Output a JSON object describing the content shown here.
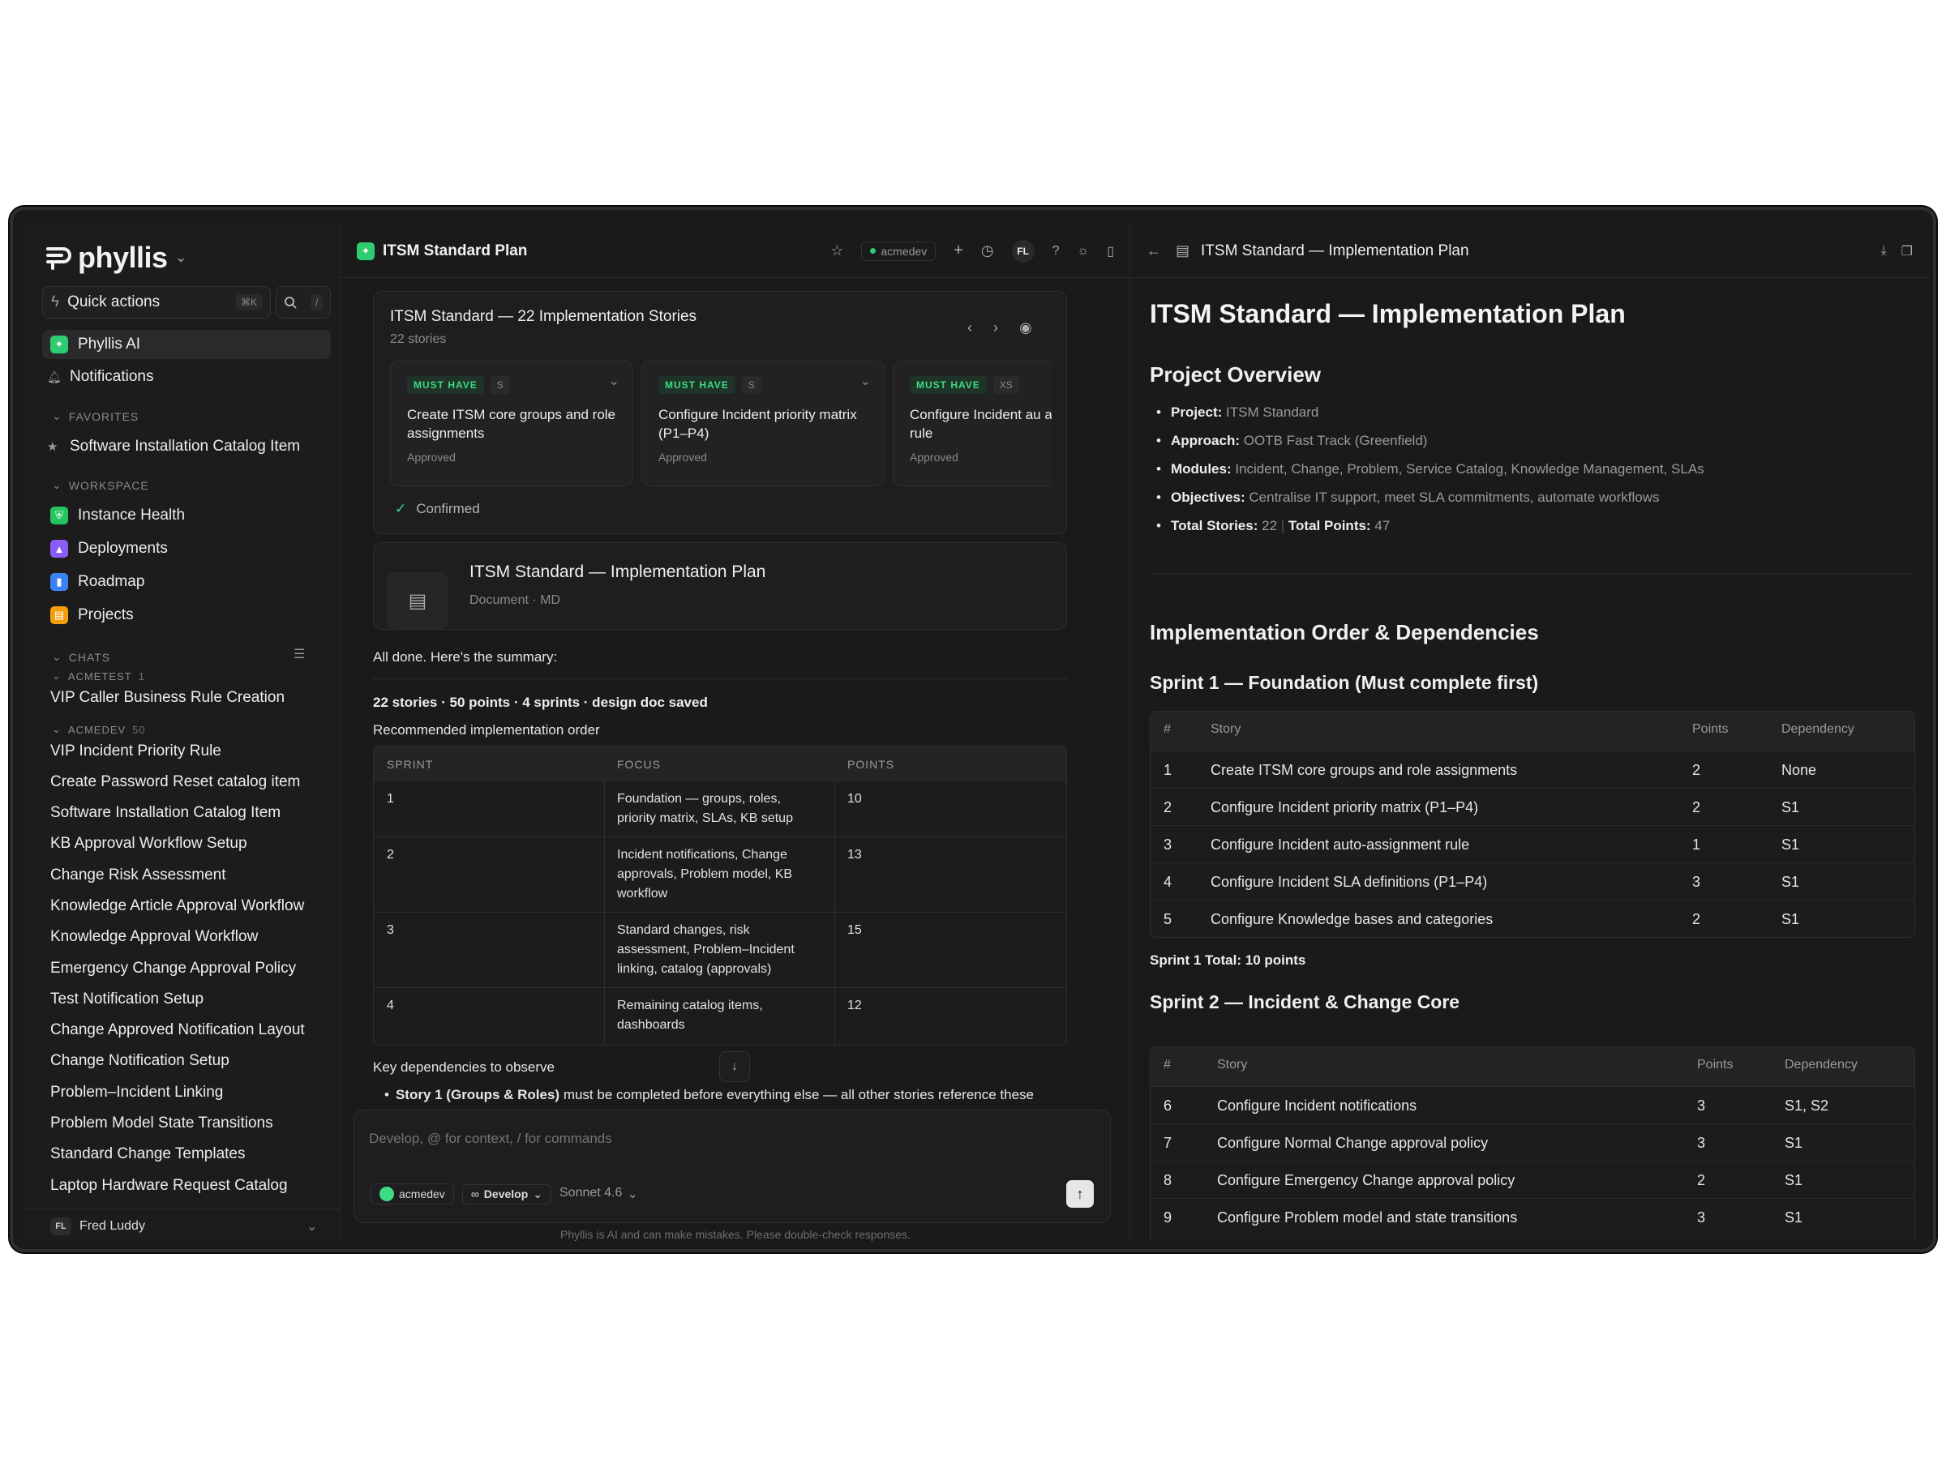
{
  "sidebar": {
    "brand": "phyllis",
    "quick_actions": "Quick actions",
    "quick_kbd": "⌘K",
    "search_kbd": "/",
    "phyllis_ai": "Phyllis AI",
    "notifications": "Notifications",
    "favorites_label": "FAVORITES",
    "favorite_item": "Software Installation Catalog Item",
    "workspace_label": "WORKSPACE",
    "workspace": [
      "Instance Health",
      "Deployments",
      "Roadmap",
      "Projects"
    ],
    "chats_label": "CHATS",
    "group1": {
      "name": "ACMETEST",
      "count": "1",
      "items": [
        "VIP Caller Business Rule Creation"
      ]
    },
    "group2": {
      "name": "ACMEDEV",
      "count": "50",
      "items": [
        "VIP Incident Priority Rule",
        "Create Password Reset catalog item",
        "Software Installation Catalog Item",
        "KB Approval Workflow Setup",
        "Change Risk Assessment",
        "Knowledge Article Approval Workflow",
        "Knowledge Approval Workflow",
        "Emergency Change Approval Policy",
        "Test Notification Setup",
        "Change Approved Notification Layout",
        "Change Notification Setup",
        "Problem–Incident Linking",
        "Problem Model State Transitions",
        "Standard Change Templates",
        "Laptop Hardware Request Catalog"
      ]
    },
    "user_initials": "FL",
    "user_name": "Fred Luddy"
  },
  "chat": {
    "title": "ITSM Standard Plan",
    "instance": "acmedev",
    "avatar": "FL",
    "stories_card": {
      "title": "ITSM Standard — 22 Implementation Stories",
      "subtitle": "22 stories",
      "stories": [
        {
          "priority": "MUST HAVE",
          "size": "S",
          "title": "Create ITSM core groups and role assignments",
          "status": "Approved"
        },
        {
          "priority": "MUST HAVE",
          "size": "S",
          "title": "Configure Incident priority matrix (P1–P4)",
          "status": "Approved"
        },
        {
          "priority": "MUST HAVE",
          "size": "XS",
          "title": "Configure Incident au assignment rule",
          "status": "Approved"
        }
      ],
      "confirmed": "Confirmed"
    },
    "doc_card": {
      "title": "ITSM Standard — Implementation Plan",
      "meta": "Document · MD"
    },
    "summary_intro": "All done. Here's the summary:",
    "summary_stats": "22 stories · 50 points · 4 sprints · design doc saved",
    "order_label": "Recommended implementation order",
    "table": {
      "headers": [
        "SPRINT",
        "FOCUS",
        "POINTS"
      ],
      "rows": [
        {
          "sprint": "1",
          "focus": "Foundation — groups, roles, priority matrix, SLAs, KB setup",
          "points": "10"
        },
        {
          "sprint": "2",
          "focus": "Incident notifications, Change approvals, Problem model, KB workflow",
          "points": "13"
        },
        {
          "sprint": "3",
          "focus": "Standard changes, risk assessment, Problem–Incident linking, catalog (approvals)",
          "points": "15"
        },
        {
          "sprint": "4",
          "focus": "Remaining catalog items, dashboards",
          "points": "12"
        }
      ]
    },
    "deps_label": "Key dependencies to observe",
    "dep_bold": "Story 1 (Groups & Roles)",
    "dep_rest": " must be completed before everything else — all other stories reference these",
    "composer_placeholder": "Develop, @ for context, / for commands",
    "composer_instance": "acmedev",
    "composer_mode": "Develop",
    "composer_model": "Sonnet 4.6",
    "disclaimer": "Phyllis is AI and can make mistakes. Please double-check responses."
  },
  "doc": {
    "header_title": "ITSM Standard — Implementation Plan",
    "title": "ITSM Standard — Implementation Plan",
    "overview_heading": "Project Overview",
    "overview": [
      {
        "label": "Project:",
        "value": "ITSM Standard"
      },
      {
        "label": "Approach:",
        "value": "OOTB Fast Track (Greenfield)"
      },
      {
        "label": "Modules:",
        "value": "Incident, Change, Problem, Service Catalog, Knowledge Management, SLAs"
      },
      {
        "label": "Objectives:",
        "value": "Centralise IT support, meet SLA commitments, automate workflows"
      }
    ],
    "total_stories_label": "Total Stories:",
    "total_stories": "22",
    "total_points_label": "Total Points:",
    "total_points": "47",
    "order_heading": "Implementation Order & Dependencies",
    "sprint1_heading": "Sprint 1 — Foundation (Must complete first)",
    "table_headers": [
      "#",
      "Story",
      "Points",
      "Dependency"
    ],
    "sprint1_rows": [
      {
        "n": "1",
        "story": "Create ITSM core groups and role assignments",
        "points": "2",
        "dep": "None"
      },
      {
        "n": "2",
        "story": "Configure Incident priority matrix (P1–P4)",
        "points": "2",
        "dep": "S1"
      },
      {
        "n": "3",
        "story": "Configure Incident auto-assignment rule",
        "points": "1",
        "dep": "S1"
      },
      {
        "n": "4",
        "story": "Configure Incident SLA definitions (P1–P4)",
        "points": "3",
        "dep": "S1"
      },
      {
        "n": "5",
        "story": "Configure Knowledge bases and categories",
        "points": "2",
        "dep": "S1"
      }
    ],
    "sprint1_total": "Sprint 1 Total: 10 points",
    "sprint2_heading": "Sprint 2 — Incident & Change Core",
    "sprint2_rows": [
      {
        "n": "6",
        "story": "Configure Incident notifications",
        "points": "3",
        "dep": "S1, S2"
      },
      {
        "n": "7",
        "story": "Configure Normal Change approval policy",
        "points": "3",
        "dep": "S1"
      },
      {
        "n": "8",
        "story": "Configure Emergency Change approval policy",
        "points": "2",
        "dep": "S1"
      },
      {
        "n": "9",
        "story": "Configure Problem model and state transitions",
        "points": "3",
        "dep": "S1"
      }
    ]
  }
}
